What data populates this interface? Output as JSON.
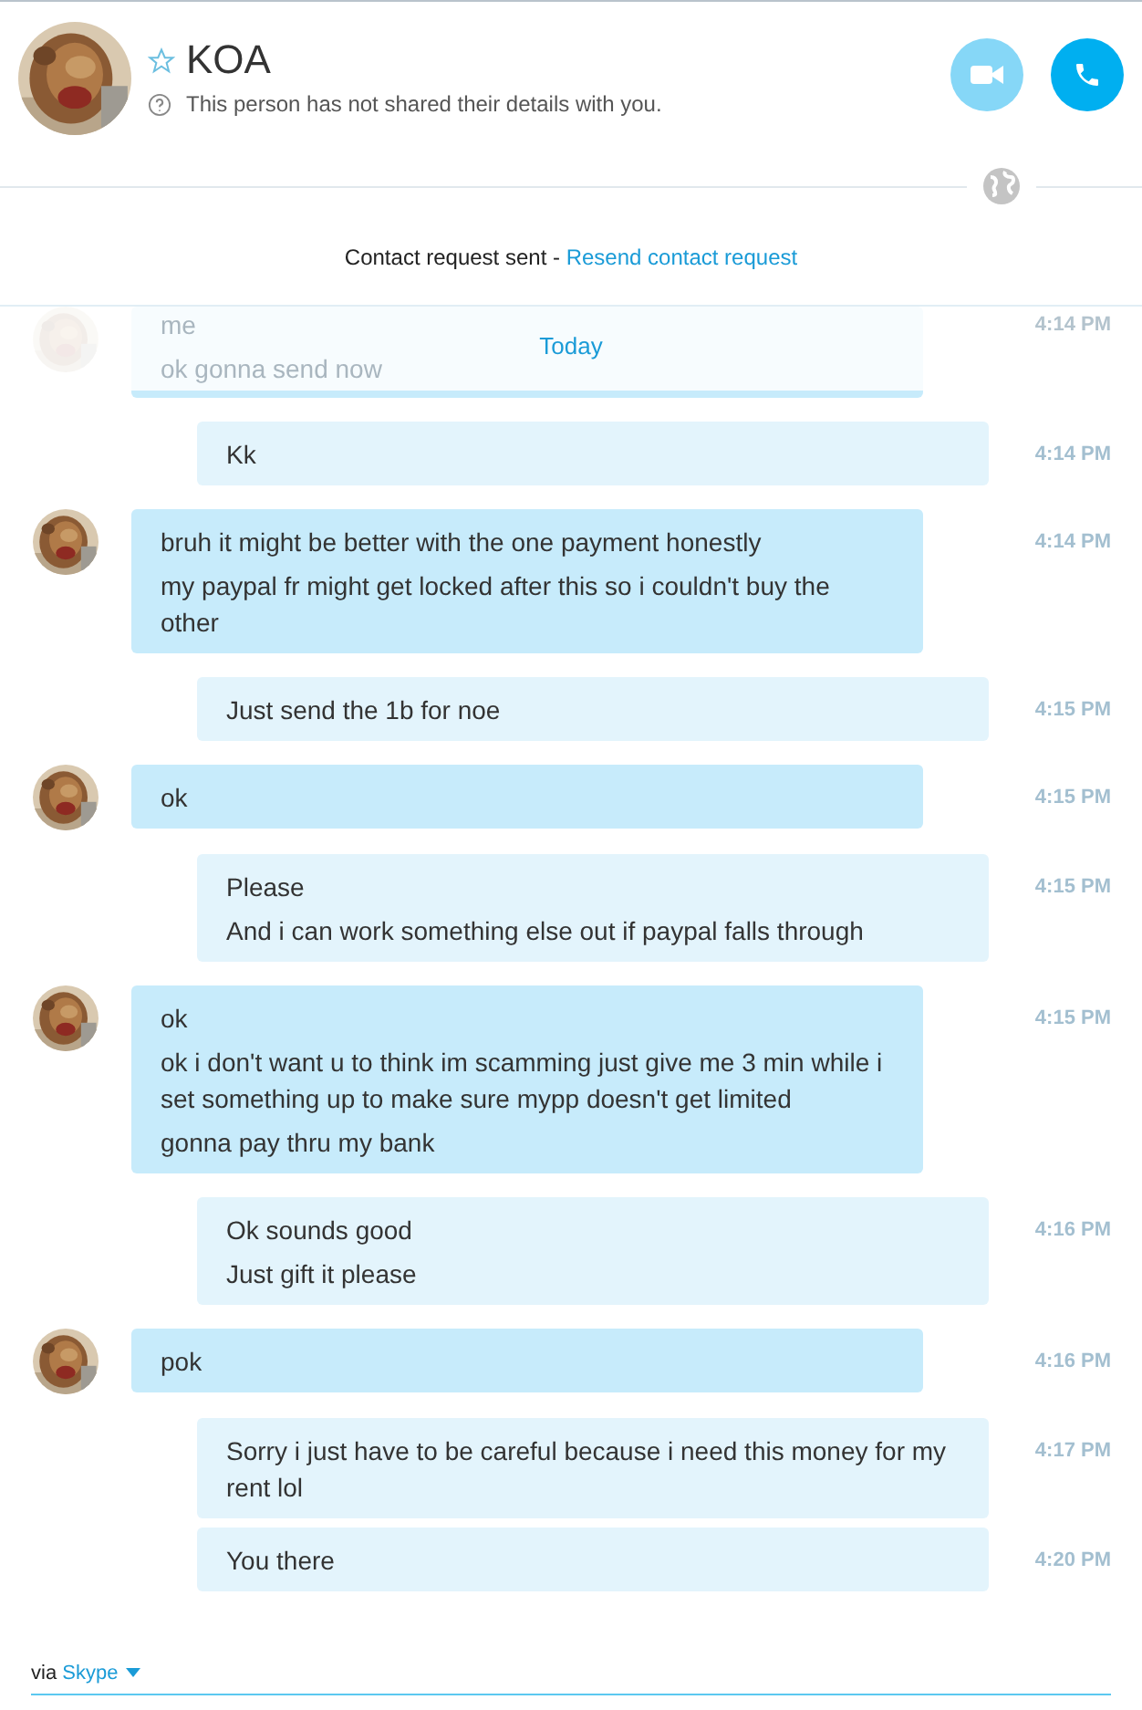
{
  "contact": {
    "name": "KOA",
    "favorite": false,
    "details_note": "This person has not shared their details with you."
  },
  "call_buttons": [
    {
      "kind": "video"
    },
    {
      "kind": "call"
    }
  ],
  "request_notice": {
    "text": "Contact request sent -",
    "link": "Resend contact request"
  },
  "date_divider": "Today",
  "messages": [
    {
      "kind": "incoming",
      "faded": true,
      "lines": [
        "me",
        "ok gonna send now"
      ],
      "time": "4:14 PM"
    },
    {
      "kind": "outgoing",
      "faded": false,
      "lines": [
        "Kk"
      ],
      "time": "4:14 PM"
    },
    {
      "kind": "incoming",
      "faded": false,
      "lines": [
        "bruh it might be better with the one payment honestly",
        "my paypal fr might get locked after this  so i couldn't buy the other"
      ],
      "time": "4:14 PM"
    },
    {
      "kind": "outgoing",
      "faded": false,
      "lines": [
        "Just send the 1b for noe"
      ],
      "time": "4:15 PM"
    },
    {
      "kind": "incoming",
      "faded": false,
      "lines": [
        "ok"
      ],
      "time": "4:15 PM"
    },
    {
      "kind": "outgoing",
      "faded": false,
      "lines": [
        "Please",
        "And i can work something else out if paypal falls through"
      ],
      "time": "4:15 PM"
    },
    {
      "kind": "incoming",
      "faded": false,
      "lines": [
        "ok",
        "ok i don't want u to think im scamming just give me 3 min while i set something up to make sure mypp doesn't get limited",
        "gonna pay thru my bank"
      ],
      "time": "4:15 PM"
    },
    {
      "kind": "outgoing",
      "faded": false,
      "lines": [
        "Ok sounds good",
        "Just gift it please"
      ],
      "time": "4:16 PM"
    },
    {
      "kind": "incoming",
      "faded": false,
      "lines": [
        "pok"
      ],
      "time": "4:16 PM"
    },
    {
      "kind": "outgoing",
      "faded": false,
      "lines": [
        "Sorry i just have to be careful because i need this money for my rent lol"
      ],
      "time": "4:17 PM"
    },
    {
      "kind": "outgoing",
      "faded": false,
      "lines": [
        "You there"
      ],
      "time": "4:20 PM"
    }
  ],
  "footer": {
    "prefix": "via",
    "service": "Skype"
  }
}
